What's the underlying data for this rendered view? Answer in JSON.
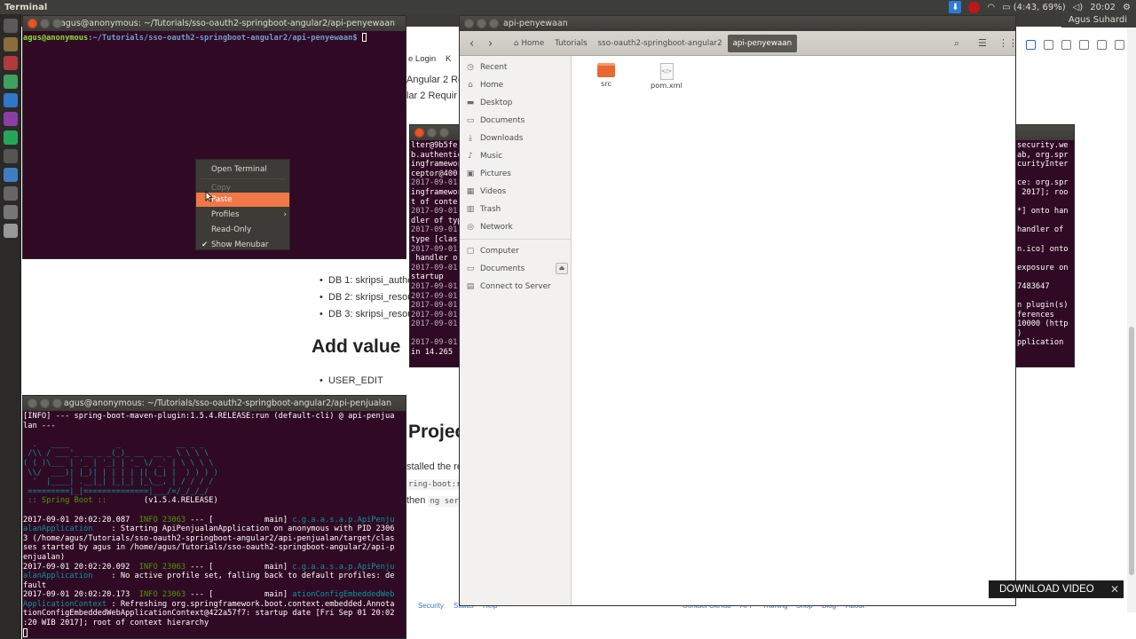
{
  "top_panel": {
    "app_title": "Terminal",
    "battery": "(4:43, 69%)",
    "clock": "20:02",
    "user_name": "Agus Suhardi"
  },
  "launcher": {
    "icons": [
      "dash-icon",
      "files-icon",
      "terminal-icon",
      "chrome-icon",
      "sublime-icon",
      "intellij-icon",
      "whatsapp-icon",
      "monitor-icon",
      "globe-icon",
      "settings-icon",
      "drive-icon",
      "trash-icon"
    ],
    "colors": [
      "#5a5a5a",
      "#8a6d3b",
      "#b23a3a",
      "#3fa15f",
      "#2e78c9",
      "#8c3fa3",
      "#26a65b",
      "#555555",
      "#3f7fbf",
      "#666666",
      "#777777",
      "#999999"
    ]
  },
  "browser": {
    "partial_lines": [
      "e Login",
      "K",
      "Angular 2 Re",
      "lar 2 Requir"
    ],
    "db_items": [
      "DB 1: skripsi_authe",
      "DB 2: skripsi_resou",
      "DB 3: skripsi_resou"
    ],
    "heading_add_value": "Add value",
    "user_edit": "USER_EDIT",
    "heading_project": "Projec",
    "installed_text": "stalled the re",
    "code_snip": "ring-boot:r",
    "then_text": "then",
    "ng_serve": "ng ser",
    "footer": [
      "Security",
      "Status",
      "Help",
      "Contact GitHub",
      "API",
      "Training",
      "Shop",
      "Blog",
      "About"
    ]
  },
  "terminal_main": {
    "title": "agus@anonymous: ~/Tutorials/sso-oauth2-springboot-angular2/api-penyewaan",
    "prompt_user": "agus@anonymous",
    "prompt_path": ":~/Tutorials/sso-oauth2-springboot-angular2/api-penyewaan$"
  },
  "context_menu": {
    "open_terminal": "Open Terminal",
    "copy": "Copy",
    "paste": "Paste",
    "profiles": "Profiles",
    "read_only": "Read-Only",
    "show_menubar": "Show Menubar"
  },
  "terminal_middle": {
    "lines": [
      "lter@9b5fe",
      "b.authentic",
      "ingframewor",
      "ceptor@400",
      "2017-09-01",
      "ingframewor",
      "t of conte",
      "2017-09-01",
      "dler of typ",
      "2017-09-01",
      "type [clas",
      "2017-09-01",
      " handler o",
      "2017-09-01",
      "startup",
      "2017-09-01",
      "2017-09-01",
      "2017-09-01",
      "2017-09-01",
      "2017-09-01",
      "",
      "2017-09-01",
      "in 14.265"
    ]
  },
  "terminal_right": {
    "lines": [
      "security.we",
      "ab, org.spr",
      "curityInter",
      "",
      "ce: org.spr",
      " 2017]; roo",
      "",
      "*] onto han",
      "",
      "handler of",
      "",
      "n.ico] onto",
      "",
      "exposure on",
      "",
      "7483647",
      "",
      "n plugin(s)",
      "ferences",
      "10000 (http",
      ")",
      "pplication"
    ]
  },
  "terminal_bottom": {
    "title": "agus@anonymous: ~/Tutorials/sso-oauth2-springboot-angular2/api-penjualan",
    "info_line": "[INFO] --- spring-boot-maven-plugin:1.5.4.RELEASE:run (default-cli) @ api-penjua",
    "info_line2": "lan ---",
    "banner": [
      "  .   ____          _            __ _ _",
      " /\\\\ / ___'_ __ _ _(_)_ __  __ _ \\ \\ \\ \\",
      "( ( )\\___ | '_ | '_| | '_ \\/ _` | \\ \\ \\ \\",
      " \\\\/  ___)| |_)| | | | | || (_| |  ) ) ) )",
      "  '  |____| .__|_| |_|_| |_\\__, | / / / /",
      " =========|_|==============|___/=/_/_/_/"
    ],
    "spring_label": " :: Spring Boot :: ",
    "spring_version": "       (v1.5.4.RELEASE)",
    "log1_ts": "2017-09-01 20:02:20.087",
    "log1_level": "  INFO 23063",
    "log1_mid": " --- [           main] ",
    "log1_cls": "c.g.a.a.s.a.p.ApiPenju",
    "log1_cls2": "alanApplication",
    "log1_msg": "    : Starting ApiPenjualanApplication on anonymous with PID 2306",
    "log1_cont": "3 (/home/agus/Tutorials/sso-oauth2-springboot-angular2/api-penjualan/target/clas\nses started by agus in /home/agus/Tutorials/sso-oauth2-springboot-angular2/api-p\nenjualan)",
    "log2_ts": "2017-09-01 20:02:20.092",
    "log2_level": "  INFO 23063",
    "log2_mid": " --- [           main] ",
    "log2_cls": "c.g.a.a.s.a.p.ApiPenju",
    "log2_cls2": "alanApplication",
    "log2_msg": "    : No active profile set, falling back to default profiles: de",
    "log2_cont": "fault",
    "log3_ts": "2017-09-01 20:02:20.173",
    "log3_level": "  INFO 23063",
    "log3_mid": " --- [           main] ",
    "log3_cls": "ationConfigEmbeddedWeb",
    "log3_cls2": "ApplicationContext",
    "log3_msg": " : Refreshing org.springframework.boot.context.embedded.Annota",
    "log3_cont": "tionConfigEmbeddedWebApplicationContext@422a57f7: startup date [Fri Sep 01 20:02\n:20 WIB 2017]; root of context hierarchy"
  },
  "files": {
    "title": "api-penyewaan",
    "breadcrumbs": [
      "Home",
      "Tutorials",
      "sso-oauth2-springboot-angular2",
      "api-penyewaan"
    ],
    "sidebar": [
      {
        "label": "Recent",
        "icon": "clock-icon"
      },
      {
        "label": "Home",
        "icon": "home-icon"
      },
      {
        "label": "Desktop",
        "icon": "folder-icon"
      },
      {
        "label": "Documents",
        "icon": "documents-icon"
      },
      {
        "label": "Downloads",
        "icon": "download-icon"
      },
      {
        "label": "Music",
        "icon": "music-icon"
      },
      {
        "label": "Pictures",
        "icon": "pictures-icon"
      },
      {
        "label": "Videos",
        "icon": "videos-icon"
      },
      {
        "label": "Trash",
        "icon": "trash-icon"
      },
      {
        "label": "Network",
        "icon": "network-icon"
      },
      {
        "label": "Computer",
        "icon": "computer-icon"
      },
      {
        "label": "Documents",
        "icon": "drive-icon"
      },
      {
        "label": "Connect to Server",
        "icon": "server-icon"
      }
    ],
    "items": [
      {
        "name": "src",
        "type": "folder"
      },
      {
        "name": "pom.xml",
        "type": "xml"
      }
    ]
  },
  "download_video": {
    "label": "DOWNLOAD VIDEO"
  }
}
